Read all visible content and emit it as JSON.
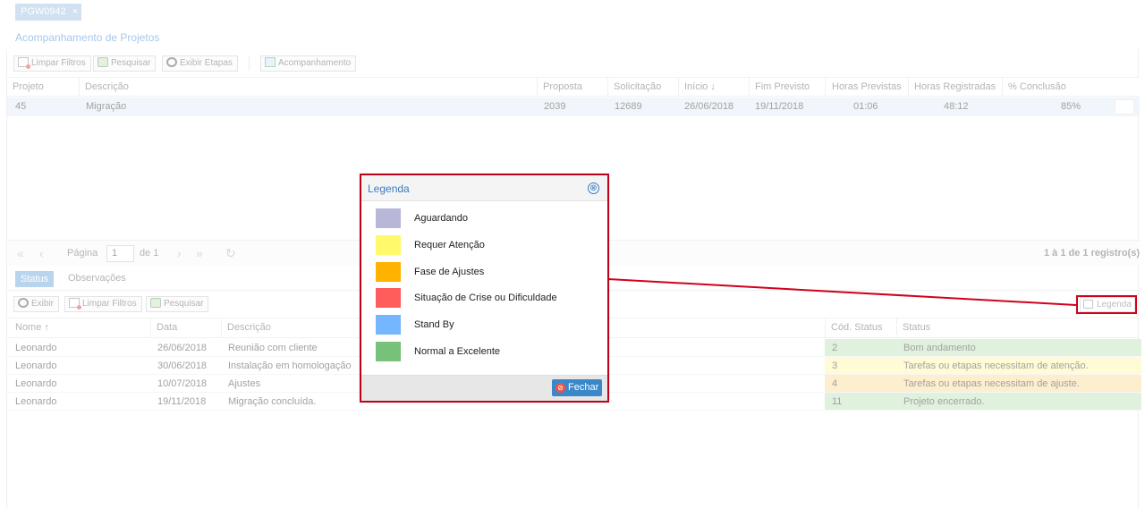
{
  "tab": {
    "label": "PGW0942",
    "close": "×"
  },
  "page_title": "Acompanhamento de Projetos",
  "toolbar": {
    "limpar_filtros": "Limpar Filtros",
    "pesquisar": "Pesquisar",
    "exibir_etapas": "Exibir Etapas",
    "acompanhamento": "Acompanhamento"
  },
  "projects_grid": {
    "columns": [
      "Projeto",
      "Descrição",
      "Proposta",
      "Solicitação",
      "Início ↓",
      "Fim Previsto",
      "Horas Previstas",
      "Horas Registradas",
      "% Conclusão"
    ],
    "rows": [
      {
        "projeto": "45",
        "descricao": "Migração",
        "proposta": "2039",
        "solicitacao": "12689",
        "inicio": "26/06/2018",
        "fim_previsto": "19/11/2018",
        "horas_previstas": "01:06",
        "horas_registradas": "48:12",
        "conclusao": "85%"
      }
    ]
  },
  "pager": {
    "first": "«",
    "prev": "‹",
    "label_pagina": "Página",
    "page": "1",
    "label_de": "de 1",
    "next": "›",
    "last": "»",
    "refresh": "↻",
    "info": "1 à 1 de 1 registro(s)"
  },
  "lower_tabs": {
    "status": "Status",
    "observacoes": "Observações"
  },
  "lower_toolbar": {
    "exibir": "Exibir",
    "limpar_filtros": "Limpar Filtros",
    "pesquisar": "Pesquisar",
    "legenda": "Legenda"
  },
  "status_grid": {
    "columns": [
      "Nome ↑",
      "Data",
      "Descrição",
      "Cód. Status",
      "Status"
    ],
    "rows": [
      {
        "nome": "Leonardo",
        "data": "26/06/2018",
        "descricao": "Reunião com cliente",
        "cod": "2",
        "status": "Bom andamento",
        "color": "#c7e6c1"
      },
      {
        "nome": "Leonardo",
        "data": "30/06/2018",
        "descricao": "Instalação em homologação",
        "cod": "3",
        "status": "Tarefas ou etapas necessitam de atenção.",
        "color": "#fdf8b4"
      },
      {
        "nome": "Leonardo",
        "data": "10/07/2018",
        "descricao": "Ajustes",
        "cod": "4",
        "status": "Tarefas ou etapas necessitam de ajuste.",
        "color": "#fce0a6"
      },
      {
        "nome": "Leonardo",
        "data": "19/11/2018",
        "descricao": "Migração concluída.",
        "cod": "11",
        "status": "Projeto encerrado.",
        "color": "#c7e6c1"
      }
    ]
  },
  "legend_dialog": {
    "title": "Legenda",
    "close_icon": "⊗",
    "items": [
      {
        "label": "Aguardando",
        "color": "#b8b6d9"
      },
      {
        "label": "Requer Atenção",
        "color": "#fff96b"
      },
      {
        "label": "Fase de Ajustes",
        "color": "#ffb200"
      },
      {
        "label": "Situação de Crise ou Dificuldade",
        "color": "#ff5c5c"
      },
      {
        "label": "Stand By",
        "color": "#74b6ff"
      },
      {
        "label": "Normal a Excelente",
        "color": "#77c17b"
      }
    ],
    "fechar": "Fechar"
  },
  "highlight_color": "#d0021b"
}
